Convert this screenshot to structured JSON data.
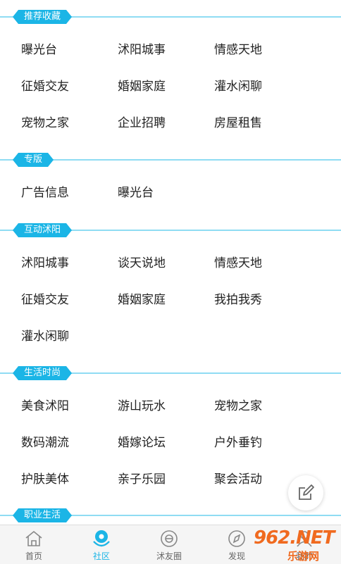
{
  "sections": [
    {
      "title": "推荐收藏",
      "items": [
        "曝光台",
        "沭阳城事",
        "情感天地",
        "征婚交友",
        "婚姻家庭",
        "灌水闲聊",
        "宠物之家",
        "企业招聘",
        "房屋租售"
      ]
    },
    {
      "title": "专版",
      "items": [
        "广告信息",
        "曝光台"
      ]
    },
    {
      "title": "互动沭阳",
      "items": [
        "沭阳城事",
        "谈天说地",
        "情感天地",
        "征婚交友",
        "婚姻家庭",
        "我拍我秀",
        "灌水闲聊"
      ]
    },
    {
      "title": "生活时尚",
      "items": [
        "美食沭阳",
        "游山玩水",
        "宠物之家",
        "数码潮流",
        "婚嫁论坛",
        "户外垂钓",
        "护肤美体",
        "亲子乐园",
        "聚会活动"
      ]
    },
    {
      "title": "职业生活",
      "items": []
    }
  ],
  "tabbar": {
    "tabs": [
      {
        "label": "首页",
        "icon": "home-icon"
      },
      {
        "label": "社区",
        "icon": "community-icon"
      },
      {
        "label": "沭友圈",
        "icon": "circle-icon"
      },
      {
        "label": "发现",
        "icon": "discover-icon"
      },
      {
        "label": "我的",
        "icon": "profile-icon"
      }
    ],
    "active_index": 1
  },
  "fab": {
    "icon": "edit-icon"
  },
  "watermark": {
    "brand": "962.NET",
    "subtitle": "乐游网"
  },
  "colors": {
    "accent": "#1bb5e6",
    "line": "#8fdcf3"
  }
}
